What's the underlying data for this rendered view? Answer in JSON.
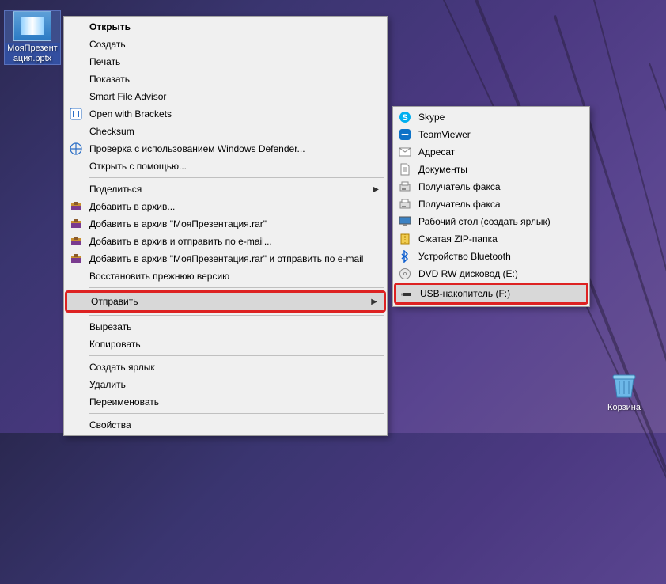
{
  "desktop": {
    "file_label": "МояПрезентация.pptx",
    "trash_label": "Корзина"
  },
  "main_menu": [
    {
      "label": "Открыть",
      "bold": true
    },
    {
      "label": "Создать"
    },
    {
      "label": "Печать"
    },
    {
      "label": "Показать"
    },
    {
      "label": "Smart File Advisor"
    },
    {
      "label": "Open with Brackets",
      "icon": "brackets"
    },
    {
      "label": "Checksum"
    },
    {
      "label": "Проверка с использованием Windows Defender...",
      "icon": "defender"
    },
    {
      "label": "Открыть с помощью...",
      "sep_after": true
    },
    {
      "label": "Поделиться",
      "arrow": true
    },
    {
      "label": "Добавить в архив...",
      "icon": "winrar"
    },
    {
      "label": "Добавить в архив \"МояПрезентация.rar\"",
      "icon": "winrar"
    },
    {
      "label": "Добавить в архив и отправить по e-mail...",
      "icon": "winrar"
    },
    {
      "label": "Добавить в архив \"МояПрезентация.rar\" и отправить по e-mail",
      "icon": "winrar"
    },
    {
      "label": "Восстановить прежнюю версию",
      "sep_after": true
    },
    {
      "label": "Отправить",
      "arrow": true,
      "highlight": true,
      "hover": true,
      "sep_after": true
    },
    {
      "label": "Вырезать"
    },
    {
      "label": "Копировать",
      "sep_after": true
    },
    {
      "label": "Создать ярлык"
    },
    {
      "label": "Удалить"
    },
    {
      "label": "Переименовать",
      "sep_after": true
    },
    {
      "label": "Свойства"
    }
  ],
  "sub_menu": [
    {
      "label": "Skype",
      "icon": "skype"
    },
    {
      "label": "TeamViewer",
      "icon": "teamviewer"
    },
    {
      "label": "Адресат",
      "icon": "mail"
    },
    {
      "label": "Документы",
      "icon": "docs"
    },
    {
      "label": "Получатель факса",
      "icon": "fax"
    },
    {
      "label": "Получатель факса",
      "icon": "fax"
    },
    {
      "label": "Рабочий стол (создать ярлык)",
      "icon": "desktop"
    },
    {
      "label": "Сжатая ZIP-папка",
      "icon": "zip"
    },
    {
      "label": "Устройство Bluetooth",
      "icon": "bluetooth"
    },
    {
      "label": "DVD RW дисковод (E:)",
      "icon": "dvd"
    },
    {
      "label": "USB-накопитель (F:)",
      "icon": "usb",
      "highlight": true,
      "hover": true
    }
  ],
  "icons": {
    "brackets": "<rect x='1' y='1' width='14' height='14' rx='2' fill='#fff' stroke='#2a6ec6'/><path d='M5 4v8M11 4v8' stroke='#2a6ec6' stroke-width='2'/>",
    "defender": "<circle cx='8' cy='8' r='7' fill='none' stroke='#2a6ec6' stroke-width='1.2'/><path d='M8 1v14M1 8h14' stroke='#2a6ec6' stroke-width='1.2'/>",
    "winrar": "<rect x='2' y='4' width='12' height='9' fill='#7a3b8f'/><rect x='2' y='4' width='12' height='3' fill='#c89030'/><rect x='6' y='2' width='4' height='4' fill='#8b5a2b'/>",
    "skype": "<circle cx='8' cy='8' r='7' fill='#00aff0'/><text x='8' y='12' text-anchor='middle' font-size='11' font-weight='bold' fill='#fff'>S</text>",
    "teamviewer": "<rect x='1' y='1' width='14' height='14' rx='3' fill='#0d72c7'/><path d='M3 8l3-2v4zM13 8l-3-2v4z' fill='#fff'/><rect x='5' y='7' width='6' height='2' fill='#fff'/>",
    "mail": "<rect x='1' y='3' width='14' height='10' fill='#fff' stroke='#888'/><path d='M1 3l7 5 7-5' fill='none' stroke='#888'/>",
    "docs": "<path d='M3 1h7l3 3v11H3z' fill='#fff' stroke='#888'/><path d='M5 6h6M5 8h6M5 10h6' stroke='#888'/>",
    "fax": "<rect x='2' y='5' width='12' height='8' fill='#ddd' stroke='#888'/><rect x='4' y='2' width='8' height='4' fill='#fff' stroke='#888'/><rect x='4' y='10' width='5' height='2' fill='#888'/>",
    "desktop": "<rect x='1' y='2' width='14' height='9' fill='#3b82c4' stroke='#555'/><rect x='5' y='11' width='6' height='2' fill='#888'/><rect x='4' y='13' width='8' height='1' fill='#888'/>",
    "zip": "<rect x='3' y='2' width='10' height='12' fill='#f0cc50' stroke='#b08000'/><path d='M8 2v12' stroke='#b08000' stroke-dasharray='1 1'/>",
    "bluetooth": "<path d='M7 1l4 4-3 3 3 3-4 4V1zM4 5l3 3-3 3' fill='none' stroke='#1060d0' stroke-width='1.5'/>",
    "dvd": "<circle cx='8' cy='8' r='6.5' fill='#e8e8e8' stroke='#888'/><circle cx='8' cy='8' r='1.5' fill='#fff' stroke='#888'/>",
    "usb": "<rect x='3' y='7' width='10' height='4' fill='#333'/><rect x='1' y='7.5' width='3' height='3' fill='#999'/>"
  }
}
